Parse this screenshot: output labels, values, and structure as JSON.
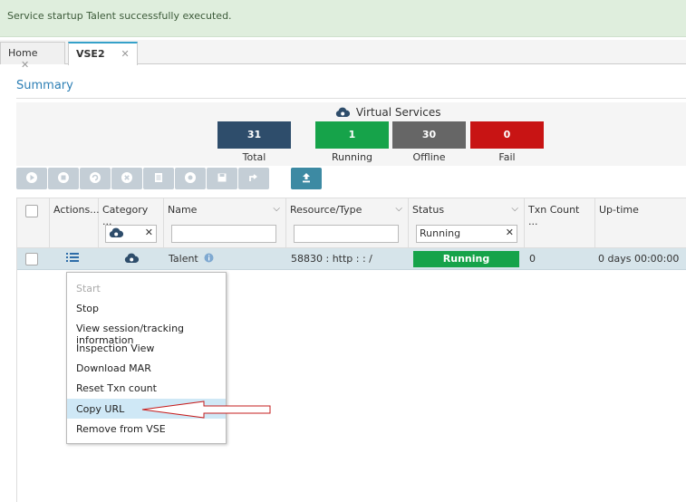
{
  "notification": {
    "text": "Service startup Talent successfully executed."
  },
  "tabs": [
    {
      "label": "Home",
      "close": "✕"
    },
    {
      "label": "VSE2",
      "close": "✕"
    }
  ],
  "summary": {
    "title": "Summary",
    "virtual_services_label": "Virtual Services",
    "stats": [
      {
        "value": "31",
        "label": "Total",
        "color": "#2e4d6b"
      },
      {
        "value": "1",
        "label": "Running",
        "color": "#16a34a"
      },
      {
        "value": "30",
        "label": "Offline",
        "color": "#666666"
      },
      {
        "value": "0",
        "label": "Fail",
        "color": "#c81414"
      }
    ]
  },
  "toolbar": {
    "icons": [
      "play-icon",
      "stop-icon",
      "refresh-icon",
      "cancel-icon",
      "document-icon",
      "deploy-icon",
      "save-icon",
      "redeploy-icon",
      "upload-icon"
    ]
  },
  "table": {
    "headers": [
      "Actions...",
      "Category ...",
      "Name",
      "Resource/Type",
      "Status",
      "Txn Count ...",
      "Up-time"
    ],
    "status_filter": "Running",
    "clear_filter_glyph": "✕",
    "rows": [
      {
        "name": "Talent",
        "resource": "58830 : http : : /",
        "status": "Running",
        "txn_count": "0",
        "uptime": "0 days 00:00:00"
      }
    ]
  },
  "context_menu": {
    "items": [
      "Start",
      "Stop",
      "View session/tracking information",
      "Inspection View",
      "Download MAR",
      "Reset Txn count",
      "Copy URL",
      "Remove from VSE"
    ]
  },
  "colors": {
    "accent": "#2d7fb5",
    "row_highlight": "#d6e4ea",
    "running": "#16a34a"
  }
}
